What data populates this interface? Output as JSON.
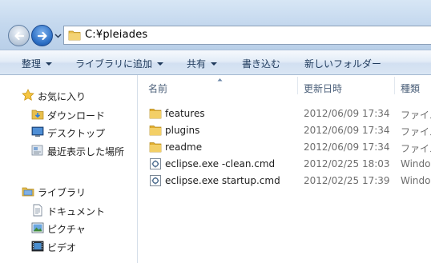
{
  "address": {
    "path": "C:¥pleiades"
  },
  "toolbar": {
    "items": [
      {
        "label": "整理",
        "has_dropdown": true
      },
      {
        "label": "ライブラリに追加",
        "has_dropdown": true
      },
      {
        "label": "共有",
        "has_dropdown": true
      },
      {
        "label": "書き込む",
        "has_dropdown": false
      },
      {
        "label": "新しいフォルダー",
        "has_dropdown": false
      }
    ]
  },
  "navpane": {
    "favorites": {
      "label": "お気に入り",
      "icon": "star-icon"
    },
    "favorite_items": [
      {
        "label": "ダウンロード",
        "icon": "downloads-folder-icon"
      },
      {
        "label": "デスクトップ",
        "icon": "desktop-icon"
      },
      {
        "label": "最近表示した場所",
        "icon": "recent-places-icon"
      }
    ],
    "libraries": {
      "label": "ライブラリ",
      "icon": "library-icon"
    },
    "library_items": [
      {
        "label": "ドキュメント",
        "icon": "documents-icon"
      },
      {
        "label": "ピクチャ",
        "icon": "pictures-icon"
      },
      {
        "label": "ビデオ",
        "icon": "videos-icon"
      }
    ]
  },
  "columns": {
    "name": "名前",
    "date": "更新日時",
    "type": "種類",
    "sorted_by": "name"
  },
  "files": [
    {
      "name": "features",
      "date": "2012/06/09 17:34",
      "type": "ファイル",
      "icon": "folder-icon"
    },
    {
      "name": "plugins",
      "date": "2012/06/09 17:34",
      "type": "ファイル",
      "icon": "folder-icon"
    },
    {
      "name": "readme",
      "date": "2012/06/09 17:34",
      "type": "ファイル",
      "icon": "folder-icon"
    },
    {
      "name": "eclipse.exe -clean.cmd",
      "date": "2012/02/25 18:03",
      "type": "Window",
      "icon": "cmd-file-icon"
    },
    {
      "name": "eclipse.exe startup.cmd",
      "date": "2012/02/25 17:39",
      "type": "Window",
      "icon": "cmd-file-icon"
    }
  ],
  "colors": {
    "toolbar_text": "#1e395b",
    "column_header_text": "#4c607a",
    "meta_text": "#6d6d6d",
    "folder": "#e8bf4c"
  }
}
